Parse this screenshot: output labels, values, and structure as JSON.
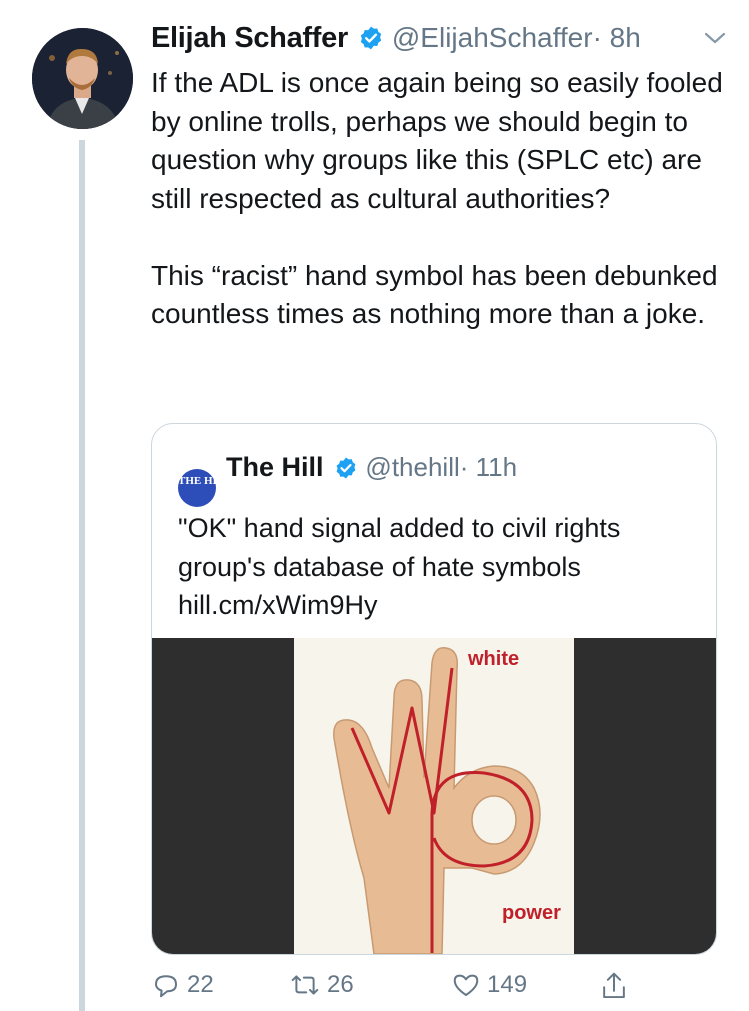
{
  "tweet": {
    "author_name": "Elijah Schaffer",
    "author_handle": "@ElijahSchaffer",
    "time": "· 8h",
    "paragraphs": [
      "If the ADL is once again being so easily fooled by online trolls, perhaps we should begin to question why groups like this (SPLC etc) are still respected as cultural authorities?",
      "This “racist” hand symbol has been debunked countless times as nothing more than a joke."
    ]
  },
  "quoted": {
    "logo_text": "THE HILL",
    "name": "The Hill",
    "handle": "@thehill",
    "time": "· 11h",
    "text": "\"OK\" hand signal added to civil rights group's database of hate symbols",
    "link": "hill.cm/xWim9Hy",
    "image_label_top": "white",
    "image_label_bottom": "power"
  },
  "actions": {
    "replies": "22",
    "retweets": "26",
    "likes": "149"
  },
  "colors": {
    "verified": "#1da1f2",
    "muted": "#657786",
    "thread_line": "#ccd6dd",
    "annotation": "#c0202a"
  }
}
